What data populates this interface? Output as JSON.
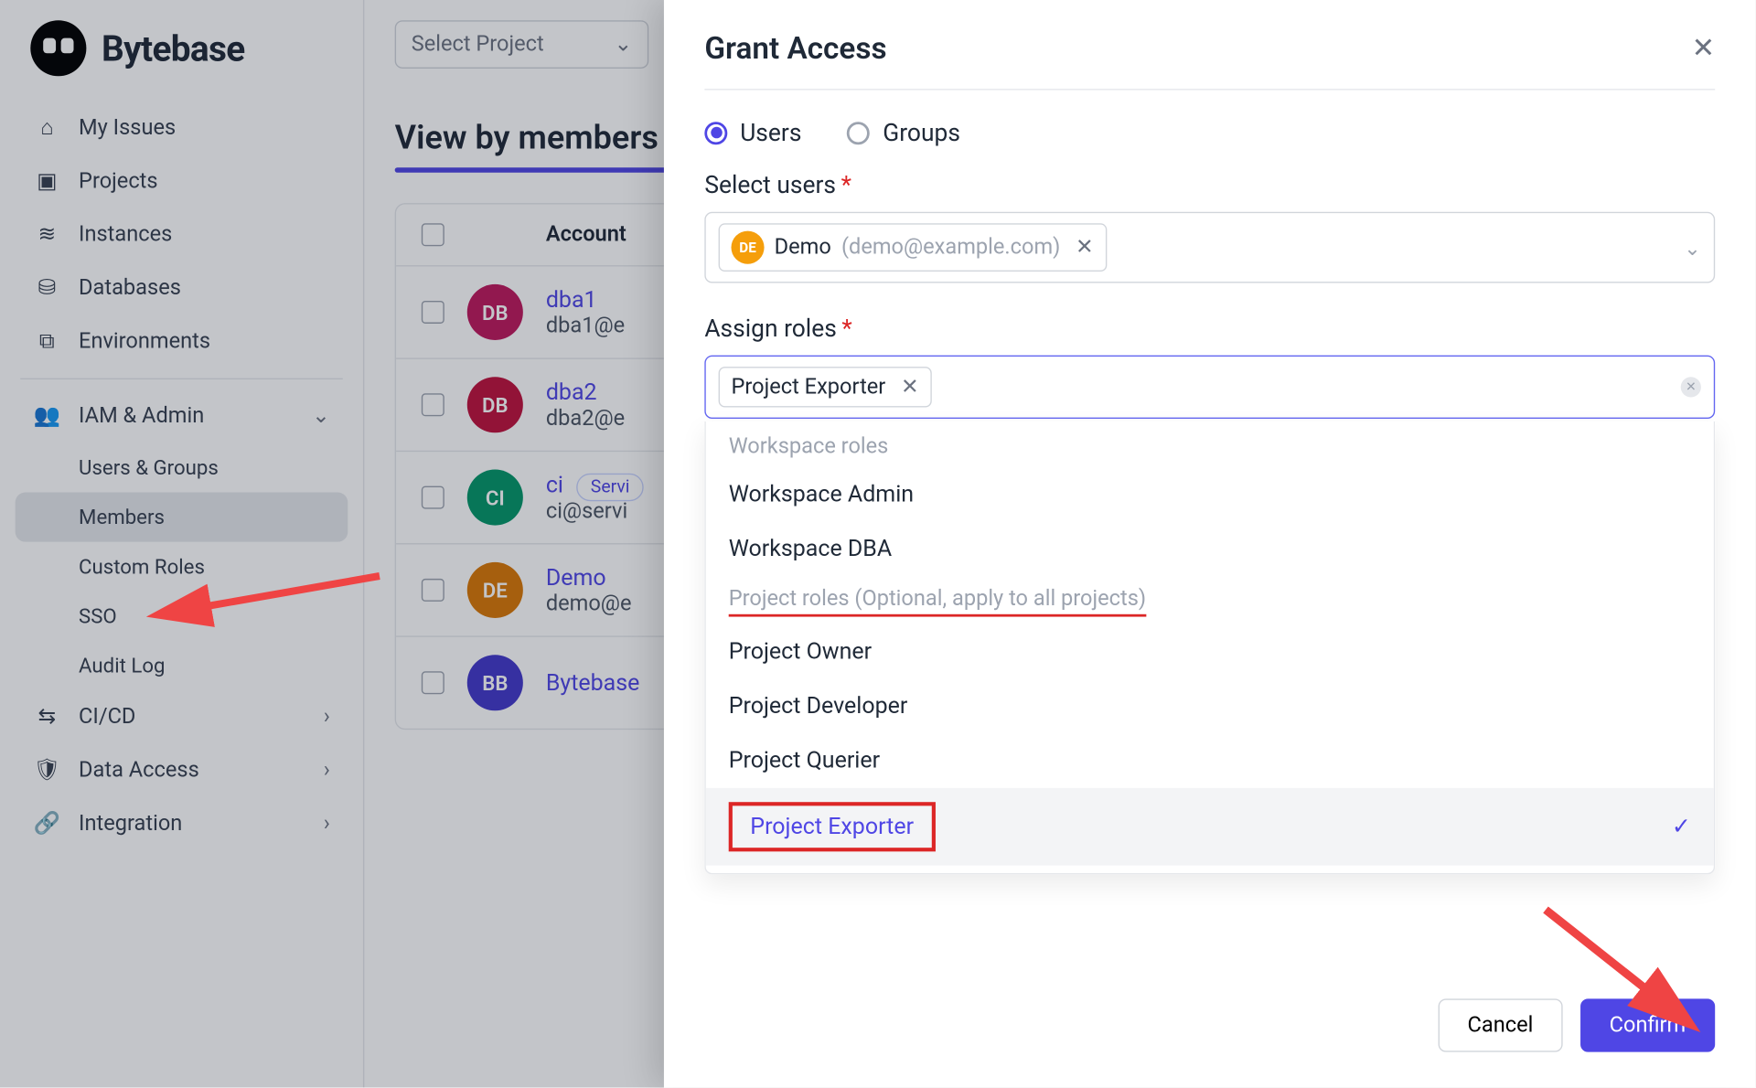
{
  "brand": "Bytebase",
  "sidebar": {
    "items": [
      "My Issues",
      "Projects",
      "Instances",
      "Databases",
      "Environments"
    ],
    "iam_label": "IAM & Admin",
    "iam_items": [
      "Users & Groups",
      "Members",
      "Custom Roles",
      "SSO",
      "Audit Log"
    ],
    "bottom": [
      "CI/CD",
      "Data Access",
      "Integration"
    ]
  },
  "main": {
    "project_placeholder": "Select Project",
    "heading": "View by members",
    "col_account": "Account",
    "rows": [
      {
        "initials": "DB",
        "color": "#be185d",
        "name": "dba1",
        "email": "dba1@e",
        "badge": null
      },
      {
        "initials": "DB",
        "color": "#be123c",
        "name": "dba2",
        "email": "dba2@e",
        "badge": null
      },
      {
        "initials": "CI",
        "color": "#059669",
        "name": "ci",
        "email": "ci@servi",
        "badge": "Servi"
      },
      {
        "initials": "DE",
        "color": "#d97706",
        "name": "Demo",
        "email": "demo@e",
        "badge": null
      },
      {
        "initials": "BB",
        "color": "#4338ca",
        "name": "Bytebase",
        "email": "",
        "badge": null
      }
    ]
  },
  "modal": {
    "title": "Grant Access",
    "radio_users": "Users",
    "radio_groups": "Groups",
    "select_users_label": "Select users",
    "selected_user": {
      "initials": "DE",
      "name": "Demo",
      "email": "(demo@example.com)"
    },
    "assign_roles_label": "Assign roles",
    "selected_role": "Project Exporter",
    "group_workspace": "Workspace roles",
    "group_project": "Project roles (Optional, apply to all projects)",
    "options": {
      "wadmin": "Workspace Admin",
      "wdba": "Workspace DBA",
      "powner": "Project Owner",
      "pdev": "Project Developer",
      "pquer": "Project Querier",
      "pexp": "Project Exporter"
    },
    "cancel": "Cancel",
    "confirm": "Confirm"
  }
}
